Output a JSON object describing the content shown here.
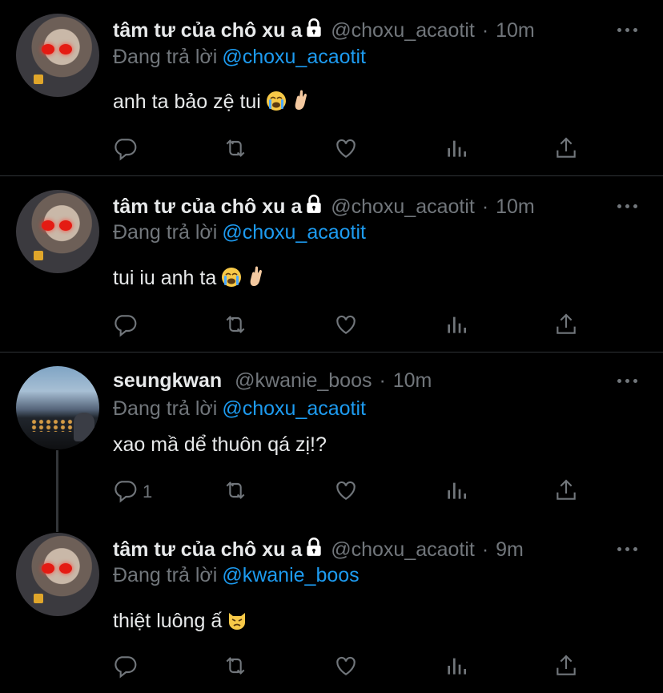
{
  "tweets": [
    {
      "name": "tâm tư của chô xu a",
      "handle": "@choxu_acaotit",
      "time": "10m",
      "replying_prefix": "Đang trả lời",
      "replying_to": "@choxu_acaotit",
      "text": "anh ta bảo zệ tui",
      "emojis": [
        "loudly-crying-face",
        "hand-with-index-finger-and-thumb-crossed"
      ],
      "reply_count": ""
    },
    {
      "name": "tâm tư của chô xu a",
      "handle": "@choxu_acaotit",
      "time": "10m",
      "replying_prefix": "Đang trả lời",
      "replying_to": "@choxu_acaotit",
      "text": "tui iu anh ta",
      "emojis": [
        "loudly-crying-face",
        "hand-with-index-finger-and-thumb-crossed"
      ],
      "reply_count": ""
    },
    {
      "name": "seungkwan",
      "handle": "@kwanie_boos",
      "time": "10m",
      "replying_prefix": "Đang trả lời",
      "replying_to": "@choxu_acaotit",
      "text": "xao mầ dể thuôn qá zị!?",
      "emojis": [],
      "reply_count": "1"
    },
    {
      "name": "tâm tư của chô xu a",
      "handle": "@choxu_acaotit",
      "time": "9m",
      "replying_prefix": "Đang trả lời",
      "replying_to": "@kwanie_boos",
      "text": "thiệt luông ấ",
      "emojis": [
        "pouting-cat-face"
      ],
      "reply_count": ""
    }
  ],
  "separator": "·",
  "colors": {
    "background": "#000000",
    "text": "#e7e9ea",
    "secondary": "#71767b",
    "link": "#1d9bf0",
    "divider": "#2f3336"
  },
  "icons": [
    "reply-icon",
    "retweet-icon",
    "like-icon",
    "analytics-icon",
    "share-icon",
    "more-icon",
    "lock-icon"
  ]
}
